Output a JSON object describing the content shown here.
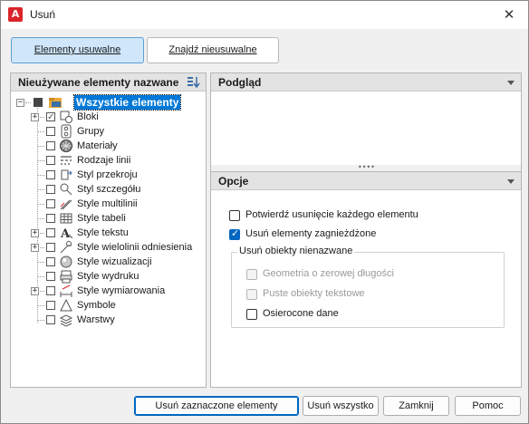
{
  "window": {
    "title": "Usuń",
    "app_icon_letter": "A",
    "close_glyph": "✕"
  },
  "tabs": [
    {
      "label": "Elementy usuwalne",
      "active": true
    },
    {
      "label": "Znajdź nieusuwalne",
      "active": false
    }
  ],
  "tree_panel": {
    "header": "Nieużywane elementy nazwane",
    "root": {
      "label": "Wszystkie elementy"
    },
    "items": [
      {
        "label": "Bloki",
        "expandable": true,
        "checked": true,
        "icon": "block-icon"
      },
      {
        "label": "Grupy",
        "expandable": false,
        "checked": false,
        "icon": "group-icon"
      },
      {
        "label": "Materiały",
        "expandable": false,
        "checked": false,
        "icon": "material-icon"
      },
      {
        "label": "Rodzaje linii",
        "expandable": false,
        "checked": false,
        "icon": "linetype-icon"
      },
      {
        "label": "Styl przekroju",
        "expandable": false,
        "checked": false,
        "icon": "section-style-icon"
      },
      {
        "label": "Styl szczegółu",
        "expandable": false,
        "checked": false,
        "icon": "detail-style-icon"
      },
      {
        "label": "Style multilinii",
        "expandable": false,
        "checked": false,
        "icon": "multiline-style-icon"
      },
      {
        "label": "Style tabeli",
        "expandable": false,
        "checked": false,
        "icon": "table-style-icon"
      },
      {
        "label": "Style tekstu",
        "expandable": true,
        "checked": false,
        "icon": "text-style-icon"
      },
      {
        "label": "Style wielolinii odniesienia",
        "expandable": true,
        "checked": false,
        "icon": "mleader-style-icon"
      },
      {
        "label": "Style wizualizacji",
        "expandable": false,
        "checked": false,
        "icon": "visual-style-icon"
      },
      {
        "label": "Style wydruku",
        "expandable": false,
        "checked": false,
        "icon": "plot-style-icon"
      },
      {
        "label": "Style wymiarowania",
        "expandable": true,
        "checked": false,
        "icon": "dimension-style-icon"
      },
      {
        "label": "Symbole",
        "expandable": false,
        "checked": false,
        "icon": "symbol-icon"
      },
      {
        "label": "Warstwy",
        "expandable": false,
        "checked": false,
        "icon": "layer-icon"
      }
    ]
  },
  "preview_panel": {
    "header": "Podgląd"
  },
  "options_panel": {
    "header": "Opcje",
    "confirm_each": {
      "label": "Potwierdź usunięcie każdego elementu",
      "checked": false
    },
    "purge_nested": {
      "label": "Usuń elementy zagnieżdżone",
      "checked": true
    },
    "unnamed_group": {
      "title": "Usuń obiekty nienazwane",
      "zero_length": {
        "label": "Geometria o zerowej długości",
        "checked": false,
        "disabled": true
      },
      "empty_text": {
        "label": "Puste obiekty tekstowe",
        "checked": false,
        "disabled": true
      },
      "orphaned_data": {
        "label": "Osierocone dane",
        "checked": false,
        "disabled": false
      }
    }
  },
  "buttons": {
    "purge_checked": "Usuń zaznaczone elementy",
    "purge_all": "Usuń wszystko",
    "close": "Zamknij",
    "help": "Pomoc"
  }
}
